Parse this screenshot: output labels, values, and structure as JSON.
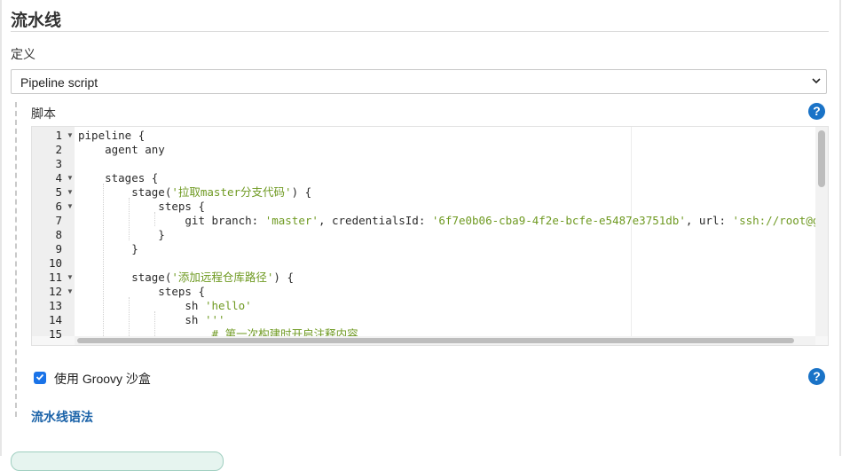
{
  "section_title": "流水线",
  "definition": {
    "label": "定义",
    "selected": "Pipeline script"
  },
  "script": {
    "label": "脚本",
    "help": "?",
    "lines": [
      {
        "num": "1",
        "fold": true,
        "parts": [
          {
            "t": "pipeline {",
            "c": "plain"
          }
        ]
      },
      {
        "num": "2",
        "fold": false,
        "parts": [
          {
            "t": "    agent any",
            "c": "plain"
          }
        ]
      },
      {
        "num": "3",
        "fold": false,
        "parts": [
          {
            "t": "",
            "c": "plain"
          }
        ]
      },
      {
        "num": "4",
        "fold": true,
        "parts": [
          {
            "t": "    stages {",
            "c": "plain"
          }
        ]
      },
      {
        "num": "5",
        "fold": true,
        "parts": [
          {
            "t": "        stage(",
            "c": "plain"
          },
          {
            "t": "'拉取master分支代码'",
            "c": "str"
          },
          {
            "t": ") {",
            "c": "plain"
          }
        ]
      },
      {
        "num": "6",
        "fold": true,
        "parts": [
          {
            "t": "            steps {",
            "c": "plain"
          }
        ]
      },
      {
        "num": "7",
        "fold": false,
        "parts": [
          {
            "t": "                git branch: ",
            "c": "plain"
          },
          {
            "t": "'master'",
            "c": "str"
          },
          {
            "t": ", credentialsId: ",
            "c": "plain"
          },
          {
            "t": "'6f7e0b06-cba9-4f2e-bcfe-e5487e3751db'",
            "c": "str"
          },
          {
            "t": ", url: ",
            "c": "plain"
          },
          {
            "t": "'ssh://root@git.yu",
            "c": "str"
          }
        ]
      },
      {
        "num": "8",
        "fold": false,
        "parts": [
          {
            "t": "            }",
            "c": "plain"
          }
        ]
      },
      {
        "num": "9",
        "fold": false,
        "parts": [
          {
            "t": "        }",
            "c": "plain"
          }
        ]
      },
      {
        "num": "10",
        "fold": false,
        "parts": [
          {
            "t": "",
            "c": "plain"
          }
        ]
      },
      {
        "num": "11",
        "fold": true,
        "parts": [
          {
            "t": "        stage(",
            "c": "plain"
          },
          {
            "t": "'添加远程仓库路径'",
            "c": "str"
          },
          {
            "t": ") {",
            "c": "plain"
          }
        ]
      },
      {
        "num": "12",
        "fold": true,
        "parts": [
          {
            "t": "            steps {",
            "c": "plain"
          }
        ]
      },
      {
        "num": "13",
        "fold": false,
        "parts": [
          {
            "t": "                sh ",
            "c": "plain"
          },
          {
            "t": "'hello'",
            "c": "str"
          }
        ]
      },
      {
        "num": "14",
        "fold": false,
        "parts": [
          {
            "t": "                sh ",
            "c": "plain"
          },
          {
            "t": "'''",
            "c": "str"
          }
        ]
      },
      {
        "num": "15",
        "fold": false,
        "parts": [
          {
            "t": "                    # 第一次构建时开启注释内容",
            "c": "comment"
          }
        ]
      }
    ]
  },
  "sandbox": {
    "label": "使用 Groovy 沙盒",
    "checked": true,
    "help": "?"
  },
  "syntax_link": "流水线语法"
}
